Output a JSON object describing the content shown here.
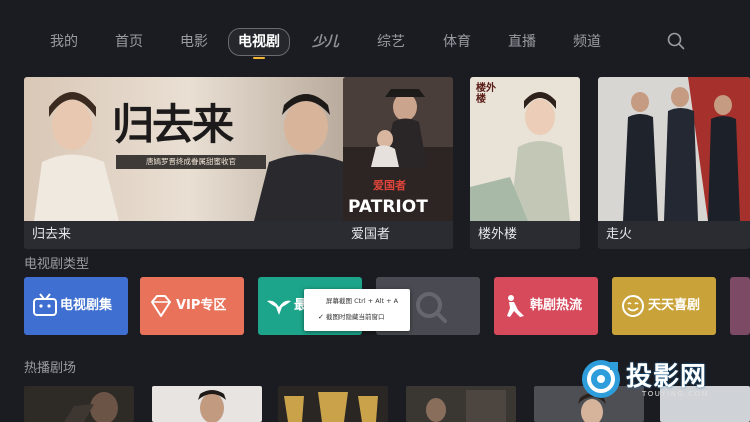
{
  "nav": {
    "items": [
      "我的",
      "首页",
      "电影",
      "电视剧",
      "少儿",
      "综艺",
      "体育",
      "直播",
      "频道"
    ],
    "active_index": 3,
    "search_icon": "search-icon"
  },
  "posters": [
    {
      "title": "归去来",
      "art_text": "归去来",
      "subtitle": "唐嫣罗晋终成眷属甜蜜收官"
    },
    {
      "title": "爱国者",
      "art_text": "PATRIOT",
      "art_text2": "爱国者"
    },
    {
      "title": "楼外楼",
      "art_text": "楼外楼"
    },
    {
      "title": "走火"
    }
  ],
  "sections": {
    "genres_title": "电视剧类型",
    "hot_title": "热播剧场"
  },
  "genres": [
    {
      "label": "电视剧集",
      "icon": "tv-icon",
      "color": "#3f6fd0"
    },
    {
      "label": "VIP专区",
      "icon": "diamond-icon",
      "color": "#e8735a"
    },
    {
      "label": "最",
      "icon": "eagle-icon",
      "color": "#1ca58a"
    },
    {
      "label": "",
      "icon": "search-icon",
      "color": "#4a4b52"
    },
    {
      "label": "韩剧热流",
      "icon": "dancer-icon",
      "color": "#d64a5c"
    },
    {
      "label": "天天喜剧",
      "icon": "smile-icon",
      "color": "#c9a33a"
    }
  ],
  "popup": {
    "item1": "屏幕截图 Ctrl + Alt + A",
    "item2": "截图时隐藏当前窗口",
    "item2_checked": true
  },
  "watermark": {
    "brand": "投影网",
    "url": "TOUYING.COM"
  },
  "colors": {
    "background": "#1b1c21",
    "accent": "#f2b534"
  }
}
